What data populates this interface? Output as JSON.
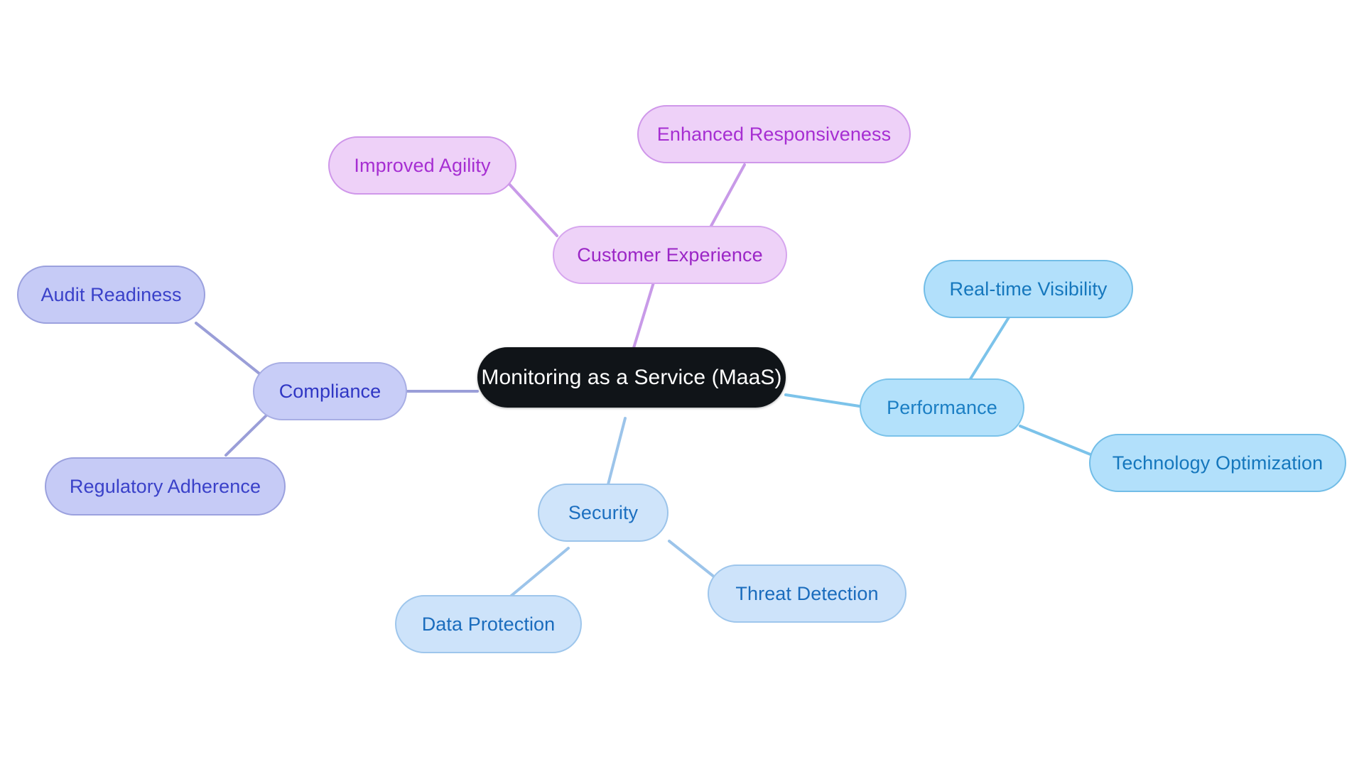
{
  "diagram": {
    "type": "mindmap",
    "background": "#ffffff",
    "root": {
      "id": "root",
      "label": "Monitoring as a Service (MaaS)",
      "fill": "#101418",
      "text_color": "#ffffff"
    },
    "branches": [
      {
        "id": "compliance",
        "label": "Compliance",
        "fill": "#c8cdf7",
        "border": "#a8aee4",
        "text_color": "#2f36c4",
        "edge_color": "#9a9ed8",
        "children": [
          {
            "id": "audit-readiness",
            "label": "Audit Readiness"
          },
          {
            "id": "regulatory-adherence",
            "label": "Regulatory Adherence"
          }
        ]
      },
      {
        "id": "customer-experience",
        "label": "Customer Experience",
        "fill": "#eed2f8",
        "border": "#d6a6ee",
        "text_color": "#9b26c6",
        "edge_color": "#c89ae8",
        "children": [
          {
            "id": "improved-agility",
            "label": "Improved Agility"
          },
          {
            "id": "enhanced-responsiveness",
            "label": "Enhanced Responsiveness"
          }
        ]
      },
      {
        "id": "performance",
        "label": "Performance",
        "fill": "#b3e1fb",
        "border": "#7bc3ea",
        "text_color": "#1b7fc4",
        "edge_color": "#7cc3ea",
        "children": [
          {
            "id": "real-time-visibility",
            "label": "Real-time Visibility"
          },
          {
            "id": "technology-optimization",
            "label": "Technology Optimization"
          }
        ]
      },
      {
        "id": "security",
        "label": "Security",
        "fill": "#cfe4fa",
        "border": "#9cc4ea",
        "text_color": "#1c6fc0",
        "edge_color": "#9cc4ea",
        "children": [
          {
            "id": "data-protection",
            "label": "Data Protection"
          },
          {
            "id": "threat-detection",
            "label": "Threat Detection"
          }
        ]
      }
    ]
  }
}
